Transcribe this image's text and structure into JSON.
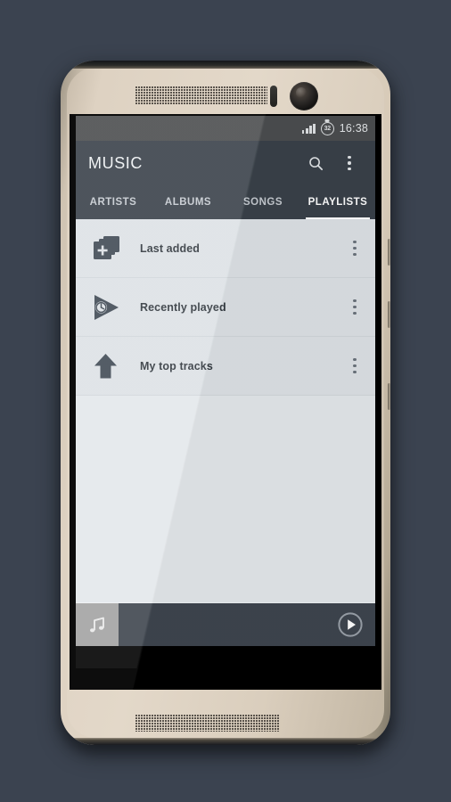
{
  "device": {
    "name": "htc-one-m8-gold",
    "frame_color": "#ded2c2",
    "bezel_color": "#000000"
  },
  "statusbar": {
    "signal_icon": "signal-bars-icon",
    "battery_icon": "battery-circle-icon",
    "battery_level": "32",
    "clock": "16:38"
  },
  "appbar": {
    "title": "MUSIC",
    "accent_color": "#394149",
    "search_icon": "search-icon",
    "overflow_icon": "overflow-menu-icon"
  },
  "tabs": {
    "items": [
      {
        "label": "ARTISTS",
        "active": false
      },
      {
        "label": "ALBUMS",
        "active": false
      },
      {
        "label": "SONGS",
        "active": false
      },
      {
        "label": "PLAYLISTS",
        "active": true
      }
    ]
  },
  "playlists": {
    "items": [
      {
        "label": "Last added",
        "icon": "stacked-cards-plus-icon",
        "menu_icon": "overflow-menu-icon"
      },
      {
        "label": "Recently played",
        "icon": "play-clock-icon",
        "menu_icon": "overflow-menu-icon"
      },
      {
        "label": "My top tracks",
        "icon": "arrow-up-icon",
        "menu_icon": "overflow-menu-icon"
      }
    ]
  },
  "nowplaying": {
    "album_art_icon": "music-note-icon",
    "track_title": "",
    "track_artist": "",
    "play_icon": "play-circle-icon",
    "bar_color": "#3e454e"
  }
}
